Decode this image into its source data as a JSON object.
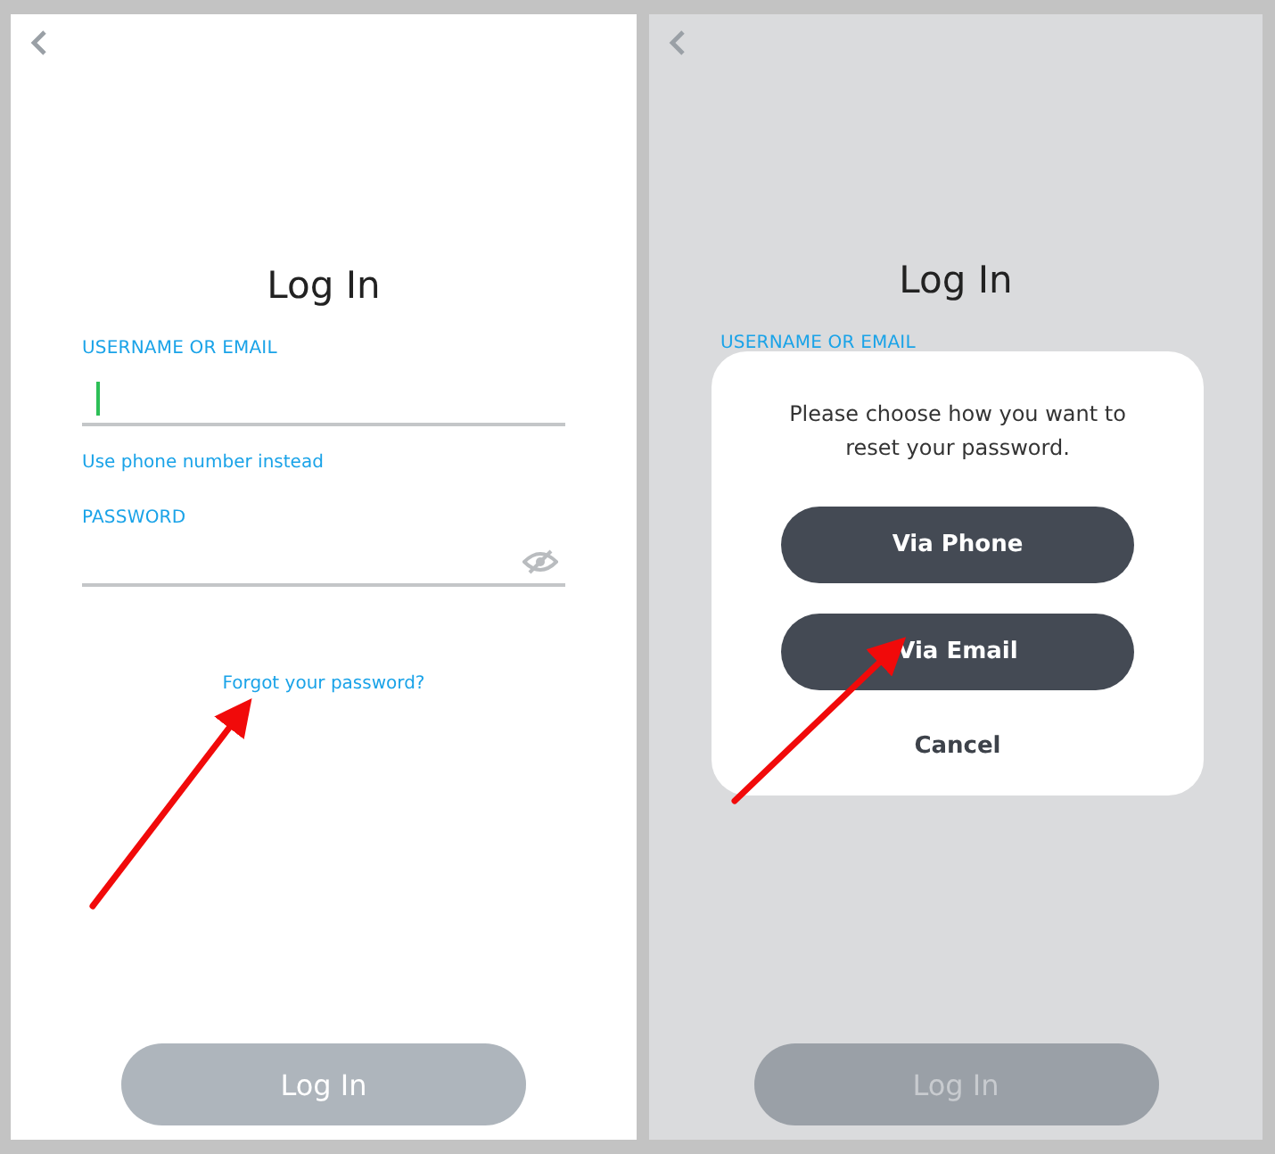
{
  "screens": [
    {
      "kind": "login",
      "dimmed": false,
      "title": "Log In",
      "username_label": "USERNAME OR EMAIL",
      "username_focused": true,
      "phone_link": "Use phone number instead",
      "password_label": "PASSWORD",
      "forgot_link": "Forgot your password?",
      "login_button": "Log In"
    },
    {
      "kind": "reset_dialog",
      "dimmed": true,
      "title": "Log In",
      "username_label": "USERNAME OR EMAIL",
      "login_button": "Log In",
      "dialog": {
        "message": "Please choose how you want to reset your password.",
        "options": [
          "Via Phone",
          "Via Email"
        ],
        "cancel": "Cancel"
      }
    }
  ]
}
